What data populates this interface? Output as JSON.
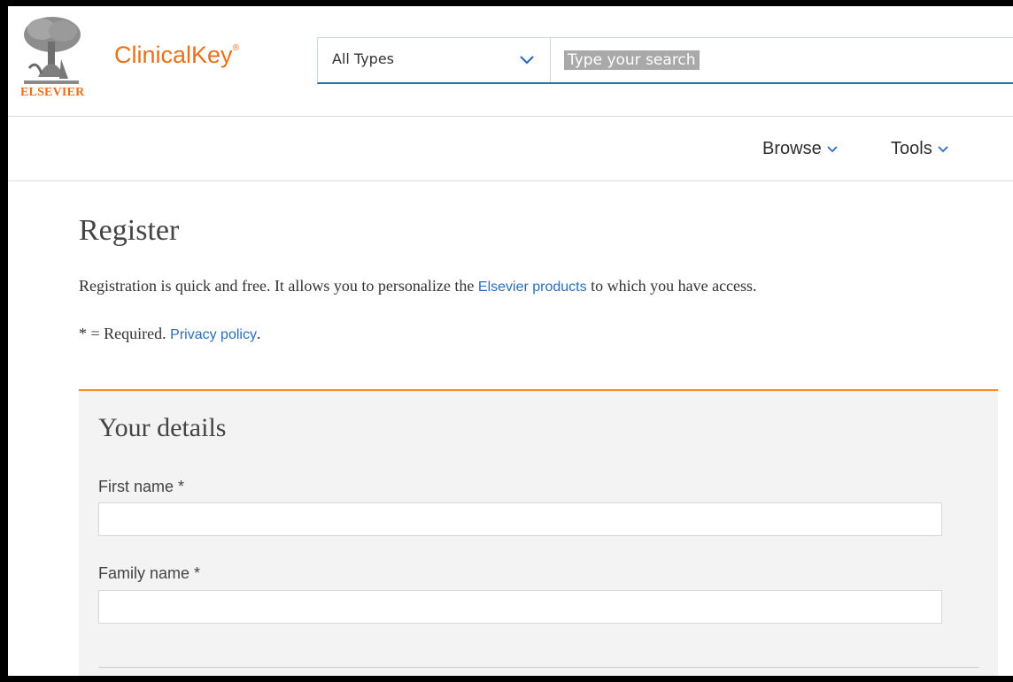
{
  "header": {
    "publisher": "ELSEVIER",
    "brand": "ClinicalKey",
    "brand_mark": "®",
    "type_select": {
      "selected": "All Types",
      "icon": "chevron-down-icon"
    },
    "search": {
      "text": "Type your search"
    }
  },
  "nav": {
    "items": [
      {
        "label": "Browse",
        "icon": "chevron-down-icon"
      },
      {
        "label": "Tools",
        "icon": "chevron-down-icon"
      }
    ]
  },
  "page": {
    "title": "Register",
    "intro_before": "Registration is quick and free. It allows you to personalize the ",
    "intro_link": "Elsevier products",
    "intro_after": " to which you have access.",
    "required_note": "* = Required. ",
    "privacy_link": "Privacy policy",
    "privacy_after": "."
  },
  "form": {
    "section_title": "Your details",
    "fields": [
      {
        "label": "First name *",
        "value": ""
      },
      {
        "label": "Family name *",
        "value": ""
      }
    ]
  },
  "colors": {
    "brand_orange": "#e9711c",
    "link_blue": "#2a6ebb",
    "panel_accent": "#f28c28",
    "panel_bg": "#f3f3f3"
  }
}
